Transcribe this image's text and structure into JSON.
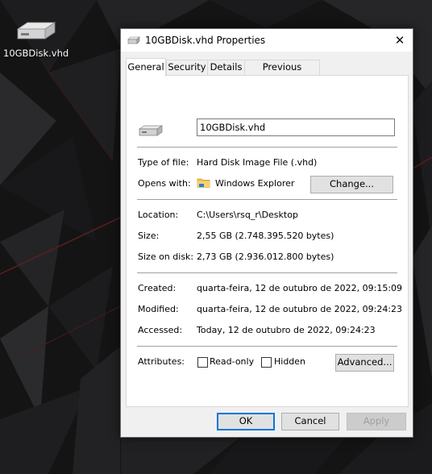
{
  "desktop": {
    "icon_label": "10GBDisk.vhd"
  },
  "window": {
    "title": "10GBDisk.vhd Properties",
    "close_glyph": "✕"
  },
  "tabs": [
    {
      "label": "General",
      "active": true
    },
    {
      "label": "Security",
      "active": false
    },
    {
      "label": "Details",
      "active": false
    },
    {
      "label": "Previous Versions",
      "active": false
    }
  ],
  "general": {
    "filename": "10GBDisk.vhd",
    "type_label": "Type of file:",
    "type_value": "Hard Disk Image File (.vhd)",
    "opens_label": "Opens with:",
    "opens_value": "Windows Explorer",
    "change_button": "Change...",
    "location_label": "Location:",
    "location_value": "C:\\Users\\rsq_r\\Desktop",
    "size_label": "Size:",
    "size_value": "2,55 GB (2.748.395.520 bytes)",
    "size_on_disk_label": "Size on disk:",
    "size_on_disk_value": "2,73 GB (2.936.012.800 bytes)",
    "created_label": "Created:",
    "created_value": "quarta-feira, 12 de outubro de 2022, 09:15:09",
    "modified_label": "Modified:",
    "modified_value": "quarta-feira, 12 de outubro de 2022, 09:24:23",
    "accessed_label": "Accessed:",
    "accessed_value": "Today, 12 de outubro de 2022, 09:24:23",
    "attributes_label": "Attributes:",
    "readonly_label": "Read-only",
    "readonly_checked": false,
    "hidden_label": "Hidden",
    "hidden_checked": false,
    "advanced_button": "Advanced..."
  },
  "footer": {
    "ok": "OK",
    "cancel": "Cancel",
    "apply": "Apply"
  },
  "colors": {
    "accent": "#0078d7",
    "folder": "#f2c14e"
  }
}
